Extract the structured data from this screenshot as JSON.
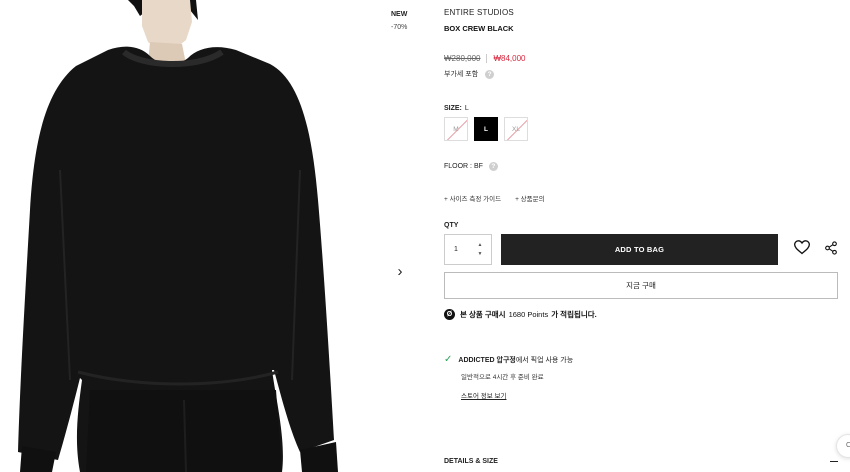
{
  "badges": {
    "new": "NEW",
    "discount": "-70%"
  },
  "product": {
    "brand": "ENTIRE STUDIOS",
    "name": "BOX CREW BLACK",
    "price_original": "₩280,000",
    "price_sale": "₩84,000",
    "vat_note": "부가세 포함",
    "help_icon": "?"
  },
  "size": {
    "label": "SIZE:",
    "current": "L",
    "options": [
      {
        "label": "M",
        "state": "soldout"
      },
      {
        "label": "L",
        "state": "selected"
      },
      {
        "label": "XL",
        "state": "soldout"
      }
    ]
  },
  "floor": {
    "label": "FLOOR : BF"
  },
  "links": {
    "size_guide": "+ 사이즈 측정 가이드",
    "inquiry": "+ 상품문의"
  },
  "quantity": {
    "label": "QTY",
    "value": "1",
    "up": "▲",
    "down": "▼"
  },
  "actions": {
    "add_to_bag": "ADD TO BAG",
    "buy_now": "지금 구매",
    "wishlist_icon": "heart-icon",
    "share_icon": "share-icon"
  },
  "points": {
    "prefix": "본 상품 구매시",
    "value": "1680 Points",
    "suffix": "가 적립됩니다.",
    "icon": "Ø"
  },
  "pickup": {
    "check": "✓",
    "store": "ADDICTED 압구정",
    "text": "에서 픽업 사용 가능",
    "sub": "일반적으로 4시간 후 준비 완료",
    "link": "스토어 정보 보기"
  },
  "details": {
    "label": "DETAILS & SIZE"
  },
  "gallery": {
    "next": "›"
  },
  "chat": {
    "label": "C"
  },
  "colors": {
    "sale": "#d6263d",
    "check": "#2e9e5b",
    "button": "#222222"
  }
}
